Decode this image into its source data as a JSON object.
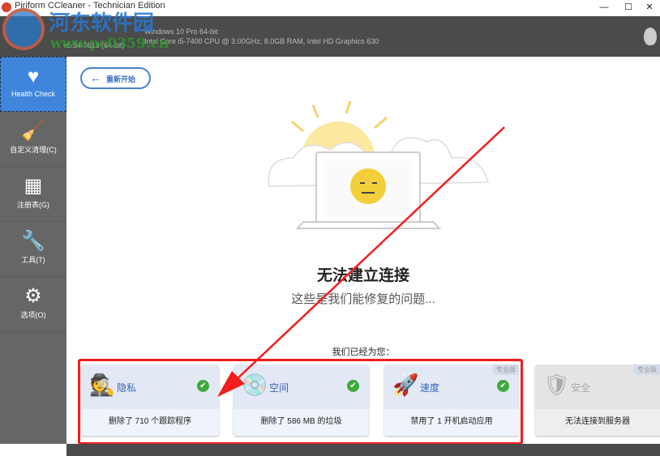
{
  "window": {
    "title": "Piriform CCleaner - Technician Edition",
    "minimize": "—",
    "maximize": "☐",
    "close": "✕"
  },
  "header": {
    "os": "Windows 10 Pro 64-bit",
    "hardware": "Intel Core i5-7400 CPU @ 3.00GHz, 8.0GB RAM, Intel HD Graphics 630",
    "version": "v5.54.7613 (64-bit)"
  },
  "watermark": {
    "name": "河东软件园",
    "url": "www.pc0359.cn"
  },
  "sidebar": {
    "items": [
      {
        "label": "Health Check",
        "icon": "heart-check-icon"
      },
      {
        "label": "自定义清理(C)",
        "icon": "broom-icon"
      },
      {
        "label": "注册表(G)",
        "icon": "grid-icon"
      },
      {
        "label": "工具(T)",
        "icon": "wrench-icon"
      },
      {
        "label": "选项(O)",
        "icon": "gear-icon"
      }
    ]
  },
  "main": {
    "back_label": "重新开始",
    "title": "无法建立连接",
    "subtitle": "这些是我们能修复的问题...",
    "done_label": "我们已经为您：",
    "cards": [
      {
        "label": "隐私",
        "result": "删除了 710 个跟踪程序",
        "icon": "spy-icon",
        "status": "check"
      },
      {
        "label": "空间",
        "result": "删除了 586 MB 的垃圾",
        "icon": "disk-icon",
        "status": "check"
      },
      {
        "label": "速度",
        "result": "禁用了 1 开机启动应用",
        "icon": "rocket-icon",
        "status": "check",
        "badge": "专业版"
      },
      {
        "label": "安全",
        "result": "无法连接到服务器",
        "icon": "shield-icon",
        "status": "disabled",
        "badge": "专业版"
      }
    ]
  },
  "colors": {
    "accent": "#3f85dc",
    "annotation": "#f21d1d",
    "success": "#3ea93e"
  }
}
